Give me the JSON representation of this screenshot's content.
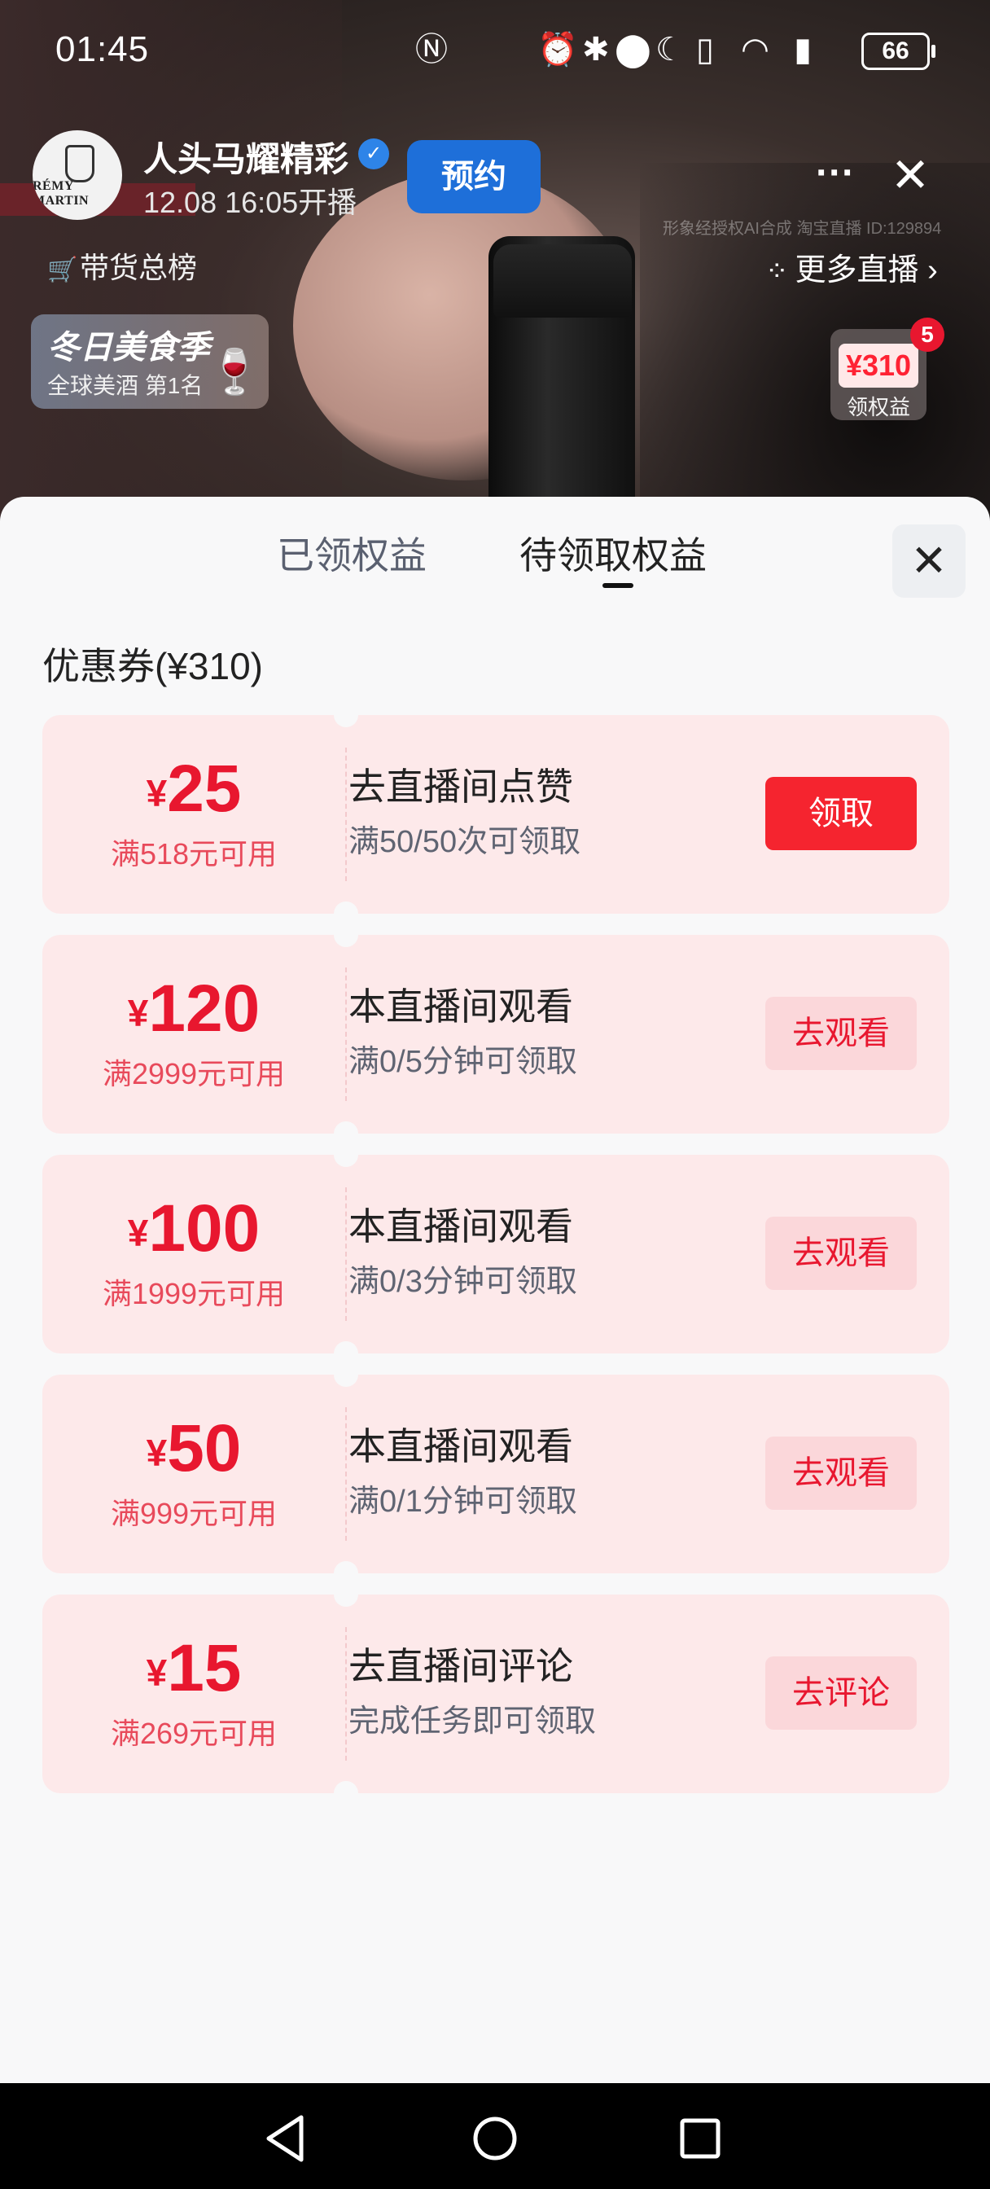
{
  "status_bar": {
    "time": "01:45",
    "battery": "66",
    "icons": [
      "nfc-icon",
      "alarm-icon",
      "bluetooth-icon",
      "location-icon",
      "moon-icon",
      "vibrate-icon",
      "wifi-icon",
      "signal-icon",
      "battery-icon"
    ]
  },
  "stream": {
    "streamer_name": "人头马耀精彩",
    "avatar_text": "RÉMY MARTIN",
    "schedule": "12.08 16:05开播",
    "reserve_label": "预约",
    "watermark": "形象经授权AI合成 淘宝直播 ID:129894",
    "rank_label": "带货总榜",
    "more_live_label": "更多直播",
    "season_card": {
      "title": "冬日美食季",
      "subtitle": "全球美酒 第1名"
    },
    "benefit_badge": {
      "amount": "¥310",
      "label": "领权益",
      "count": "5"
    }
  },
  "sheet": {
    "tabs": [
      {
        "label": "已领权益",
        "active": false
      },
      {
        "label": "待领取权益",
        "active": true
      }
    ],
    "section_title": "优惠券(¥310)",
    "coupons": [
      {
        "currency": "¥",
        "amount": "25",
        "condition": "满518元可用",
        "task": "去直播间点赞",
        "progress": "满50/50次可领取",
        "action": "领取",
        "action_type": "primary"
      },
      {
        "currency": "¥",
        "amount": "120",
        "condition": "满2999元可用",
        "task": "本直播间观看",
        "progress": "满0/5分钟可领取",
        "action": "去观看",
        "action_type": "secondary"
      },
      {
        "currency": "¥",
        "amount": "100",
        "condition": "满1999元可用",
        "task": "本直播间观看",
        "progress": "满0/3分钟可领取",
        "action": "去观看",
        "action_type": "secondary"
      },
      {
        "currency": "¥",
        "amount": "50",
        "condition": "满999元可用",
        "task": "本直播间观看",
        "progress": "满0/1分钟可领取",
        "action": "去观看",
        "action_type": "secondary"
      },
      {
        "currency": "¥",
        "amount": "15",
        "condition": "满269元可用",
        "task": "去直播间评论",
        "progress": "完成任务即可领取",
        "action": "去评论",
        "action_type": "secondary"
      }
    ]
  },
  "colors": {
    "accent_red": "#e8172f",
    "coupon_bg": "#fde9ea",
    "reserve_blue": "#1e6fd9"
  }
}
